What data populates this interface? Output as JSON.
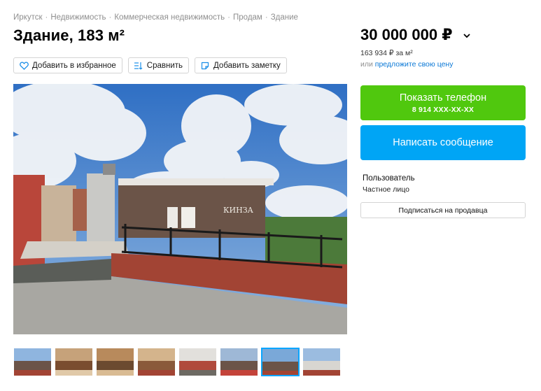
{
  "breadcrumb": [
    "Иркутск",
    "Недвижимость",
    "Коммерческая недвижимость",
    "Продам",
    "Здание"
  ],
  "breadcrumb_separator": "·",
  "title": "Здание, 183 м²",
  "actions": {
    "favorite": "Добавить в избранное",
    "compare": "Сравнить",
    "note": "Добавить заметку"
  },
  "photo": {
    "sign_text": "КИНЗА"
  },
  "thumbnails_count": 8,
  "thumbnails_active_index": 6,
  "price": {
    "value": "30 000 000 ₽",
    "per_meter": "163 934 ₽ за м²",
    "offer_prefix": "или",
    "offer_link": "предложите свою цену"
  },
  "contact": {
    "show_phone": "Показать телефон",
    "phone_masked": "8 914 XXX-XX-XX",
    "write_message": "Написать сообщение"
  },
  "seller": {
    "name": "Пользователь",
    "type": "Частное лицо",
    "subscribe": "Подписаться на продавца"
  },
  "colors": {
    "phone_button": "#50c80e",
    "message_button": "#00a5f5",
    "link": "#0a78d6",
    "active_thumb": "#0aa5ff"
  }
}
